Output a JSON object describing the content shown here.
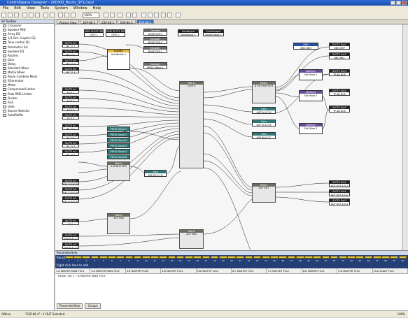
{
  "app": {
    "title": "ControlSpace Designer - 200300_Bucks_SYS.cspd",
    "menus": [
      "File",
      "Edit",
      "View",
      "Tools",
      "System",
      "Window",
      "Help"
    ],
    "zoom": "100%"
  },
  "toolbox": {
    "title": "SP ToolBox",
    "items": [
      "Crossover",
      "Speaker PEQ",
      "Array EQ",
      "1/3 Oct. Graphic EQ",
      "Tone control EQ",
      "Parametric EQ",
      "Speaker EQ",
      "Routers",
      "Gain",
      "Delay",
      "Standard Mixer",
      "Matrix Mixer",
      "Room Combine Mixer",
      "SGenerator",
      "Meter",
      "Compressor/Limiter",
      "Peak RMS Limiter",
      "Ducker",
      "AGC",
      "Gate",
      "Source Selector",
      "AutoMixMx"
    ]
  },
  "canvas": {
    "panel_title": "Project View",
    "tabs": [
      "ESP-88 1",
      "ESP-88 2",
      "ESP-88 3",
      "ESP-88 4"
    ],
    "active_tab": 3
  },
  "blocks": {
    "slot_in": [
      {
        "hdr": "SLOT1 In1",
        "txt": "MIC-D-1"
      },
      {
        "hdr": "SLOT1 In2",
        "txt": "MIC-D-2"
      },
      {
        "hdr": "SLOT1 In3",
        "txt": "MIC-D-3"
      },
      {
        "hdr": "SLOT1 In4",
        "txt": "MIC-D-4"
      },
      {
        "hdr": "SLOT2 In1",
        "txt": "AV-D-1"
      },
      {
        "hdr": "SLOT2 In2",
        "txt": "AV-D-2"
      },
      {
        "hdr": "SLOT2 In3",
        "txt": "AV-D-3"
      },
      {
        "hdr": "SLOT2 In4",
        "txt": "AV-D-4"
      },
      {
        "hdr": "SLOT3 In1",
        "txt": "WL-D-1"
      },
      {
        "hdr": "SLOT3 In2",
        "txt": "WL-D-2"
      },
      {
        "hdr": "SLOT3 In3",
        "txt": "WL-D-3"
      },
      {
        "hdr": "SLOT3 In4",
        "txt": "WL-D-4"
      },
      {
        "hdr": "SLOT4 In1",
        "txt": "RM-D BUS IN"
      },
      {
        "hdr": "SLOT4 In2",
        "txt": "RM-D BUS IN"
      },
      {
        "hdr": "SLOT4 In3",
        "txt": "RM-D BUS IN"
      },
      {
        "hdr": "SLOT5 In1",
        "txt": "M-1"
      },
      {
        "hdr": "SLOT5 In2",
        "txt": "ACP IN 6-7-1"
      },
      {
        "hdr": "SLOT5 In3",
        "txt": "ACP IN 6-7-2"
      }
    ],
    "gpio": [
      {
        "hdr": "GPIO SLOT1 GPI1",
        "txt": "GPIO 1"
      },
      {
        "hdr": "GPIO SLOT1 GPI2",
        "txt": "GPIO 2"
      }
    ],
    "decoder": {
      "hdr": "Decoder",
      "txt": "BOSE DSP-1"
    },
    "serial_in": {
      "hdr": "SerialInput",
      "txt": "SerialInput 1"
    },
    "serial_out": {
      "hdr": "SerialOutput",
      "txt": "SerialOutput 1"
    },
    "automix": {
      "hdr": "AutoMix",
      "txt": "AutoMixMx 1"
    },
    "prog_stand": {
      "hdr": "Decoder",
      "txt": "PROG Stand 1"
    },
    "matrix_main": {
      "hdr": "Matrix",
      "txt": "D MTX"
    },
    "stand_list": [
      "PROG Stand 1",
      "PROG Stand 2",
      "PROG Stand 3",
      "PROG Stand 4",
      "PROG Stand 5",
      "PROG Stand 6"
    ],
    "mixer_bus": {
      "hdr": "Matrix",
      "txt": "D IN BUS MTX"
    },
    "gain_a": {
      "hdr": "Gain",
      "txt": "ACP IN 4-7 B"
    },
    "gain_b": {
      "hdr": "Gain",
      "txt": "ACP IN 4-7 A"
    },
    "gain_c": {
      "hdr": "Gain",
      "txt": "ACP IN 4-7 B"
    },
    "gain_d": {
      "hdr": "Gain",
      "txt": "ACP IN 4-7 C"
    },
    "out_matrix": {
      "hdr": "Matrix",
      "txt": "D OUT BUS MTX"
    },
    "std_mixers": [
      {
        "hdr": "StdMixer",
        "txt": "Std Mixer 1"
      },
      {
        "hdr": "StdMixer",
        "txt": "Std Mixer 2"
      },
      {
        "hdr": "StdMixer",
        "txt": "Std Mixer 3"
      }
    ],
    "dbg": {
      "hdr": "DBG",
      "txt": "DBG DBG"
    },
    "slot_out": [
      {
        "hdr": "SLOT3 Out1",
        "txt": "DBG AMP"
      },
      {
        "hdr": "SLOT3 Out2",
        "txt": "DBG REC"
      },
      {
        "hdr": "SLOT3 Out3",
        "txt": "TP-SD BUS"
      },
      {
        "hdr": "SLOT3 Out4",
        "txt": "TP-SD BUS"
      },
      {
        "hdr": "SLOT3 Out5",
        "txt": "TP-SD BUS"
      },
      {
        "hdr": "SLOT4 Out1",
        "txt": "ACP OUT 4-5-1"
      },
      {
        "hdr": "SLOT4 Out2",
        "txt": "ACP OUT 4-5-2"
      },
      {
        "hdr": "SLOT4 Out3",
        "txt": "ACP OUT 4-5-3"
      }
    ],
    "acp_out_mtx": {
      "hdr": "Matrix",
      "txt": "ACP OUT"
    },
    "acp_sub": {
      "hdr": "Matrix",
      "txt": "ACP SUB"
    },
    "acp_in_m": {
      "hdr": "Matrix",
      "txt": "ACP SUB"
    },
    "bottom_gain": {
      "hdr": "Gain",
      "txt": "ACP IN 4-7 C"
    }
  },
  "params": {
    "title": "ParameterSets",
    "preset_label": "Recall",
    "numbers": [
      "1",
      "2",
      "3",
      "4",
      "5",
      "6",
      "7",
      "8",
      "9",
      "10",
      "11",
      "12",
      "13",
      "14",
      "15",
      "16",
      "17",
      "18",
      "19",
      "20",
      "21",
      "22",
      "23",
      "24",
      "25",
      "26",
      "27",
      "28",
      "29",
      "30",
      "31",
      "32",
      "33",
      "34",
      "35",
      "36",
      "37",
      "38",
      "39",
      "40"
    ],
    "hint": "Right click here to add",
    "columns": [
      "1.A MASTER MAIN TVC1",
      "2.A MASTER MAIN TVC2",
      "3.B MASTER PCAM",
      "4.B MASTER TVC1",
      "5.B MASTER TVC2",
      "6.C MASTER TVC1",
      "7.C MASTER TVC2",
      "8.D MASTER TVC1",
      "9.D MASTER TVC2",
      "10.A SLAVE TVC1"
    ],
    "row": "Param. Set 1 : \"A MASTER MAIN TVC1\"",
    "bottom_tabs": [
      "ParameterSets",
      "Groups"
    ]
  },
  "status": {
    "left": "ONline",
    "mid": "\"ESP-88 4\" : 1 OUT Selected",
    "right": "100%"
  },
  "colors": {
    "title_blue": "#1c4fb0",
    "header_dark": "#222222",
    "header_teal": "#2f7a78",
    "header_purple": "#6a4a9a",
    "header_orange": "#e8b83a",
    "preset_bg": "#243f76",
    "preset_yellow": "#e0c24a"
  }
}
